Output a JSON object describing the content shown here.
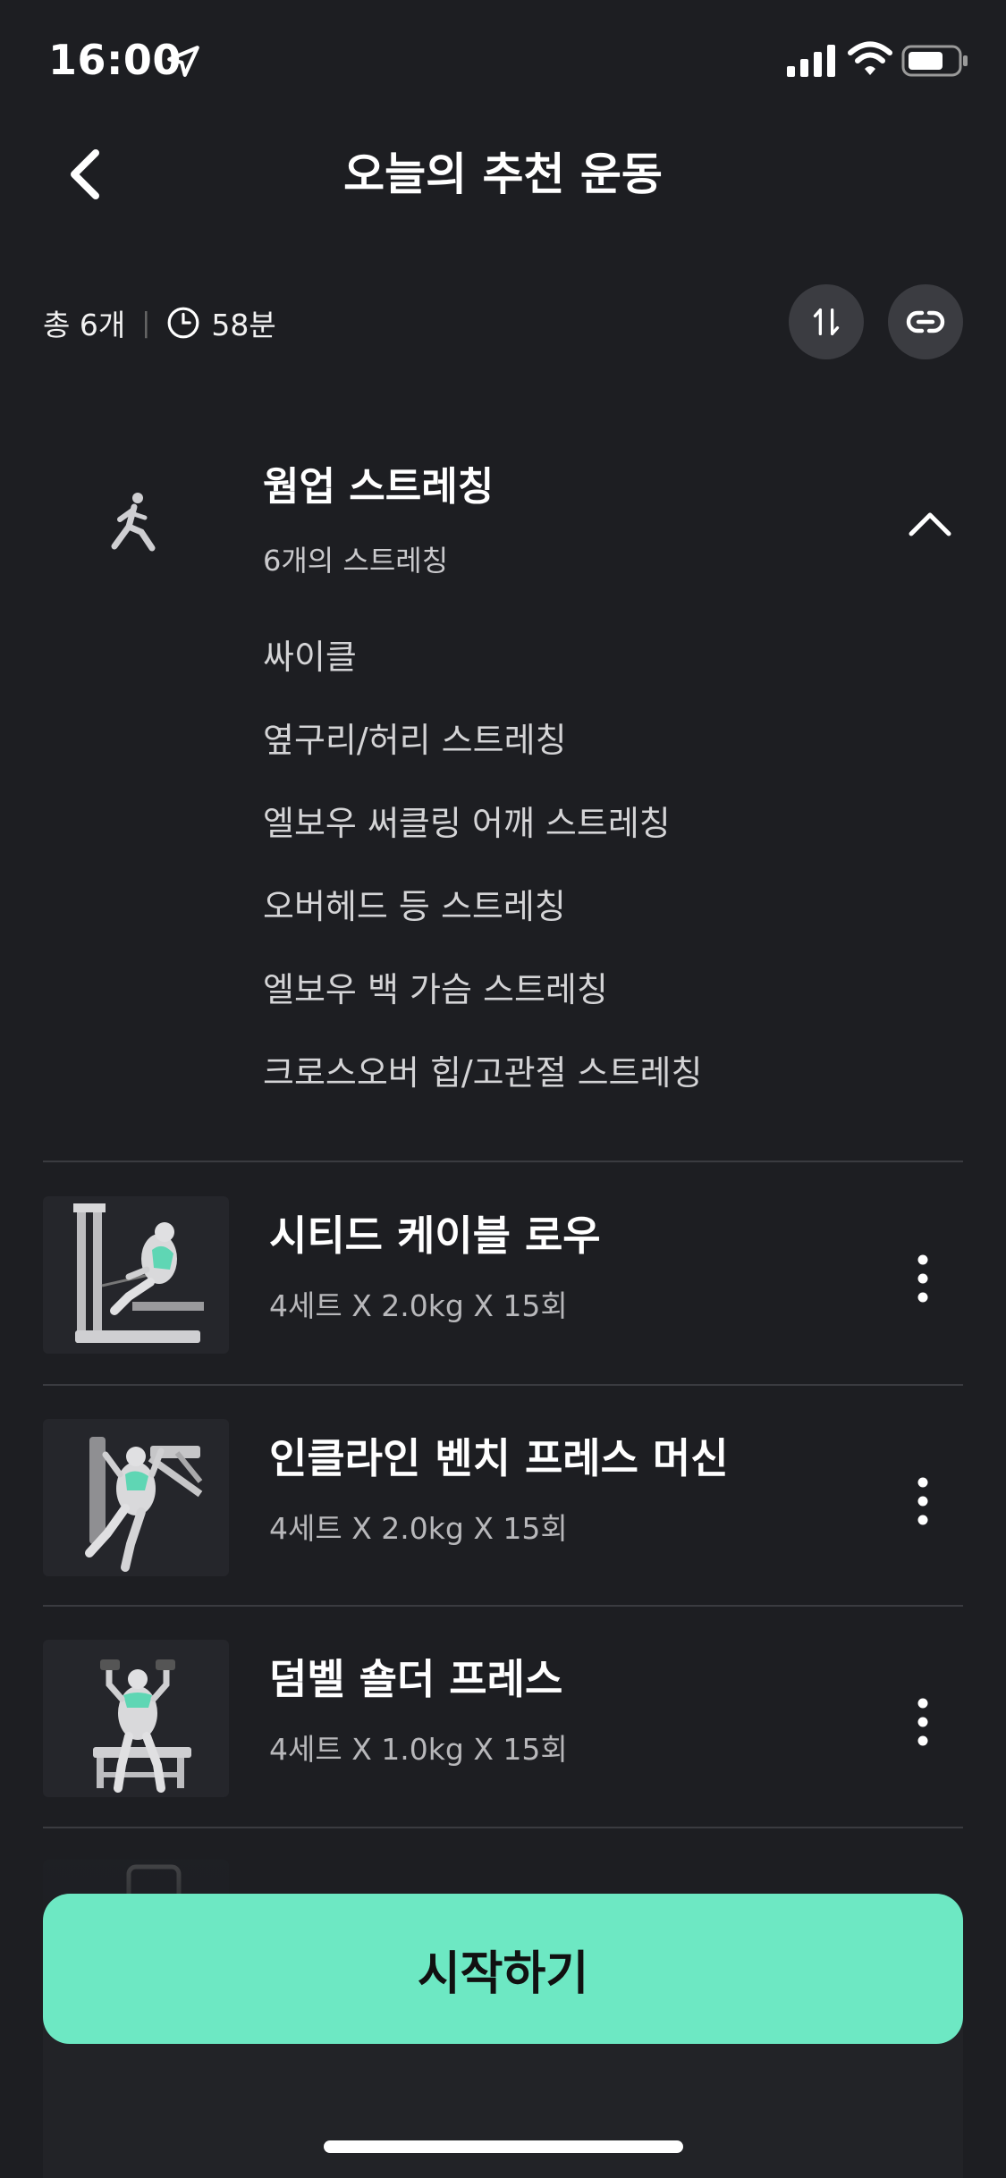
{
  "status_bar": {
    "time": "16:00",
    "icons": [
      "location-arrow-icon",
      "signal-icon",
      "wifi-icon",
      "battery-icon"
    ]
  },
  "header": {
    "title": "오늘의 추천 운동",
    "back_icon": "chevron-left-icon"
  },
  "summary": {
    "count": "총 6개",
    "divider": "|",
    "duration": "58분",
    "sort_icon": "sort-arrows-icon",
    "link_icon": "link-icon"
  },
  "warmup": {
    "title": "웜업 스트레칭",
    "subtitle": "6개의 스트레칭",
    "items": [
      "싸이클",
      "옆구리/허리 스트레칭",
      "엘보우 써클링 어깨 스트레칭",
      "오버헤드 등 스트레칭",
      "엘보우 백 가슴 스트레칭",
      "크로스오버 힙/고관절 스트레칭"
    ]
  },
  "exercises": [
    {
      "name": "시티드 케이블 로우",
      "detail": "4세트 X 2.0kg X 15회"
    },
    {
      "name": "인클라인 벤치 프레스 머신",
      "detail": "4세트 X 2.0kg X 15회"
    },
    {
      "name": "덤벨 숄더 프레스",
      "detail": "4세트 X 1.0kg X 15회"
    }
  ],
  "start_button": {
    "label": "시작하기"
  },
  "colors": {
    "background": "#1d1e22",
    "accent": "#6de8c3",
    "round_button": "#3b3c41",
    "muscle_highlight": "#5fd6b4"
  }
}
